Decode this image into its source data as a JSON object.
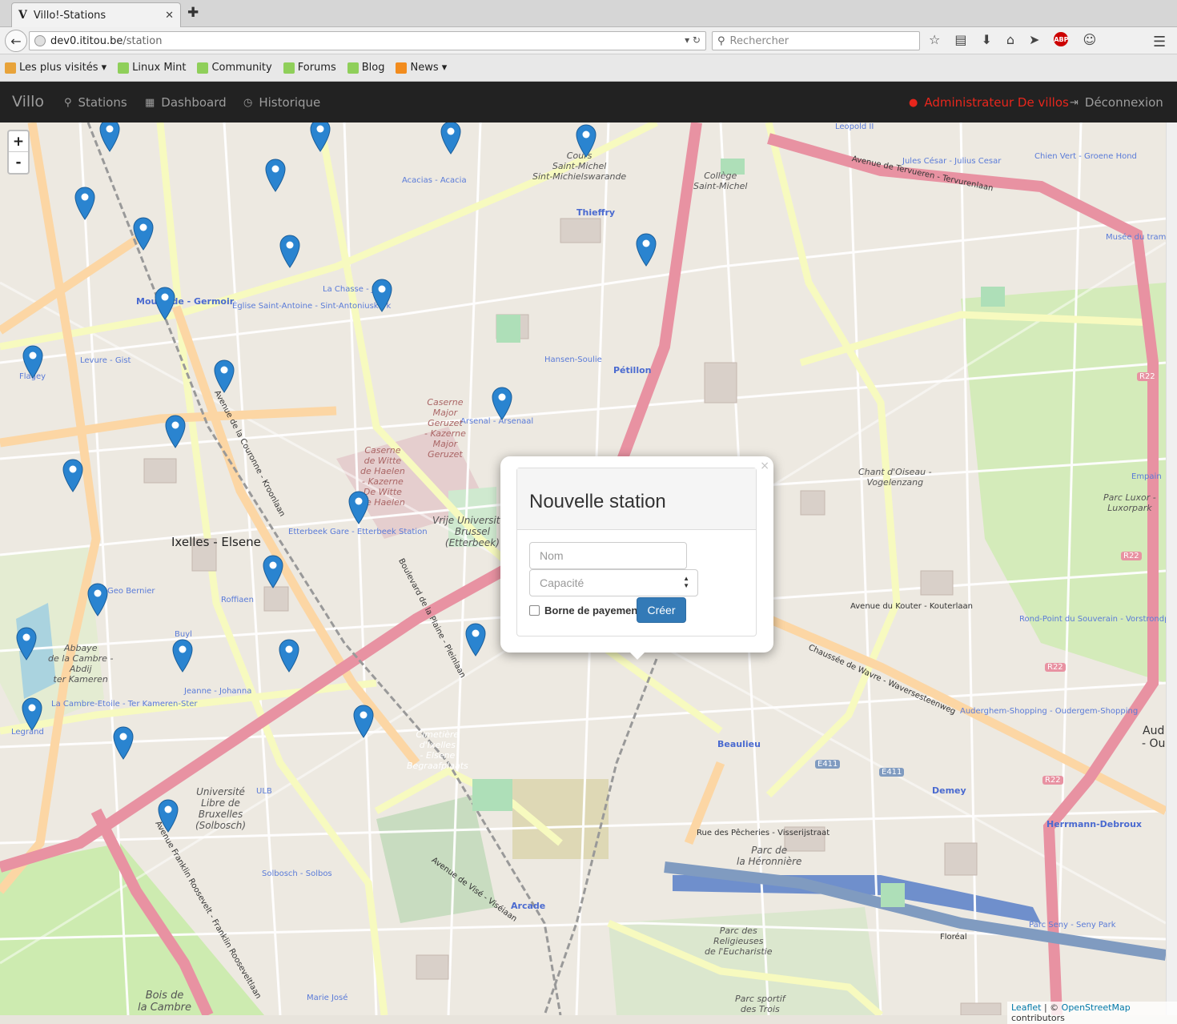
{
  "browser": {
    "tab_title": "Villo!-Stations",
    "tab_favicon": "V",
    "url_host": "dev0.ititou.be",
    "url_path": "/station",
    "search_placeholder": "Rechercher",
    "bookmarks": [
      {
        "label": "Les plus visités",
        "icon": "folder-icon",
        "dropdown": true
      },
      {
        "label": "Linux Mint",
        "icon": "mint-icon"
      },
      {
        "label": "Community",
        "icon": "mint-icon"
      },
      {
        "label": "Forums",
        "icon": "mint-icon"
      },
      {
        "label": "Blog",
        "icon": "mint-icon"
      },
      {
        "label": "News",
        "icon": "rss-icon",
        "dropdown": true
      }
    ]
  },
  "app": {
    "brand": "Villo",
    "nav": [
      {
        "label": "Stations",
        "icon": "map-marker-icon"
      },
      {
        "label": "Dashboard",
        "icon": "dashboard-icon"
      },
      {
        "label": "Historique",
        "icon": "clock-icon"
      }
    ],
    "admin_label": "Administrateur De villos",
    "logout_label": "Déconnexion",
    "admin_color": "#e7261c"
  },
  "map": {
    "zoom_in": "+",
    "zoom_out": "-",
    "attribution_leaflet": "Leaflet",
    "attribution_sep": " | © ",
    "attribution_osm": "OpenStreetMap",
    "attribution_tail": " contributors",
    "labels": {
      "ixelles": "Ixelles - Elsene",
      "cours": "Cours\nSaint-Michel\nSint-Michielswarande",
      "college": "Collège\nSaint-Michel",
      "thieffry": "Thieffry",
      "petillon": "Pétillon",
      "moutgermoir": "Mouterde - Germoir",
      "arsenal": "Arsenal - Arsenaal",
      "caserne": "Caserne\nMajor\nGeruzet\n- Kazerne\nMajor\nGeruzet",
      "caserne2": "Caserne\nde Witte\nde Haelen\n- Kazerne\nDe Witte\nde Haelen",
      "vub": "Vrije Universiteit\nBrussel\n(Etterbeek)",
      "etterbeek": "Etterbeek Gare - Etterbeek Station",
      "ulb": "Université\nLibre de\nBruxelles\n(Solbosch)",
      "cimetiere": "Cimetière\nd'Ixelles\n- Elsene\nBegraafplaats",
      "heronniere": "Parc de\nla Héronnière",
      "beaulieu": "Beaulieu",
      "demey": "Demey",
      "herrmann": "Herrmann-Debroux",
      "arcade": "Arcade",
      "bois": "Bois de\nla Cambre",
      "religieuses": "Parc des\nReligieuses\nde l'Eucharistie",
      "wavre": "Chaussée de Wavre - Waversesteenweg",
      "tervuren": "Avenue de Tervueren - Tervurenlaan",
      "couronne": "Avenue de la Couronne - Kroonlaan",
      "roosevelt": "Avenue Franklin Roosevelt - Franklin Rooseveltlaan",
      "plaine": "Boulevard de la Plaine - Pleinlaan",
      "abbaye": "Abbaye\nde la Cambre -\nAbdij\nter Kameren",
      "e411": "E411",
      "r22": "R22",
      "geo_bernier": "Geo Bernier",
      "flagey": "Flagey",
      "auderghem": "Auderghem-Shopping - Oudergem-Shopping",
      "rond_point": "Rond-Point du Souverain - Vorstrondpunt",
      "parc_seny": "Parc Seny - Seny Park",
      "chien_vert": "Chien Vert - Groene Hond",
      "jules_cesar": "Jules César - Julius Cesar",
      "musee_tram": "Musée du tram",
      "empain": "Empain",
      "luxor": "Parc Luxor -\nLuxorpark",
      "chant_oiseau": "Chant d'Oiseau -\nVogelenzang",
      "jeanne": "Jeanne - Johanna",
      "cambre_etoile": "La Cambre-Etoile - Ter Kameren-Ster",
      "roffiaen": "Roffiaen",
      "buyl": "Buyl",
      "solbosch": "Solbosch - Solbos",
      "marie_jose": "Marie José",
      "hansen": "Hansen-Soulie",
      "acacias": "Acacias - Acacia",
      "leopold": "Leopold II",
      "eglise": "Église Saint-Antoine - Sint-Antoniuskerk",
      "chasse": "La Chasse - Jacht",
      "levure": "Levure - Gist",
      "avenue_kouter": "Avenue du Kouter - Kouterlaan",
      "visé": "Avenue de Visé - Viséiaan",
      "pecheries": "Rue des Pêcheries - Visserijstraat",
      "legrand": "Legrand",
      "ulb_stop": "ULB",
      "floreal": "Floréal",
      "parc_sportif": "Parc sportif\ndes Trois\nTilleuls",
      "aud_edge": "Aud\n- Ou"
    }
  },
  "popup": {
    "title": "Nouvelle station",
    "name_placeholder": "Nom",
    "capacity_placeholder": "Capacité",
    "payment_label": "Borne de payement",
    "create_label": "Créer",
    "close_label": "×",
    "button_color": "#337ab7"
  }
}
